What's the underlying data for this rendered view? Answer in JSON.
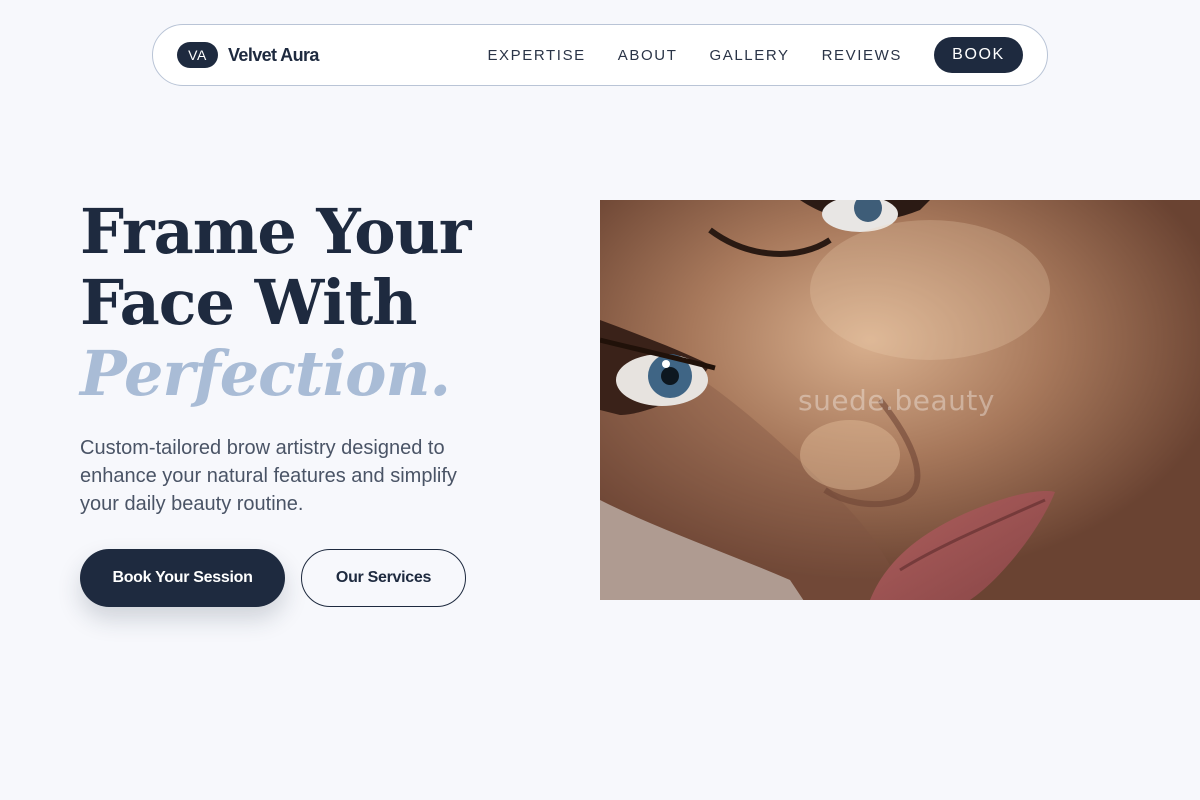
{
  "nav": {
    "logo_badge": "VA",
    "brand": "Velvet Aura",
    "links": [
      "EXPERTISE",
      "ABOUT",
      "GALLERY",
      "REVIEWS"
    ],
    "book_label": "BOOK"
  },
  "hero": {
    "title_line1": "Frame Your",
    "title_line2": "Face With",
    "title_accent": "Perfection.",
    "description": "Custom-tailored brow artistry designed to enhance your natural features and simplify your daily beauty routine.",
    "primary_button": "Book Your Session",
    "secondary_button": "Our Services",
    "image_watermark": "suede.beauty"
  },
  "colors": {
    "navy": "#1e2a3f",
    "accent": "#a9bcd6",
    "background": "#f7f8fc"
  }
}
